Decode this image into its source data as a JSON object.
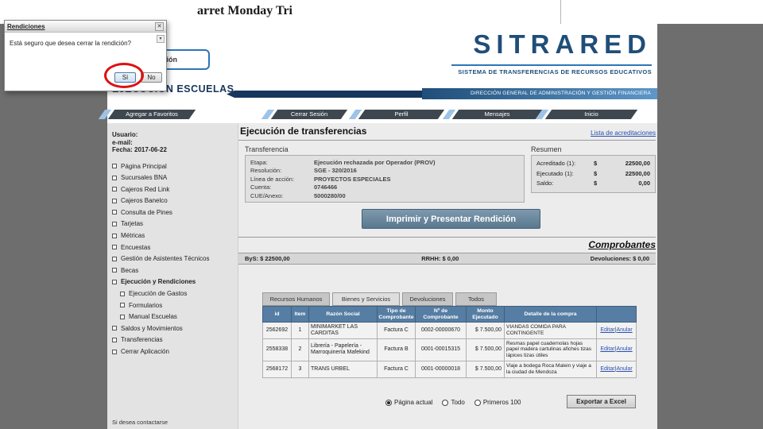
{
  "slide": {
    "top_text": "arret Monday Tri"
  },
  "dialog": {
    "title": "Rendiciones",
    "close_glyph": "✕",
    "dropdown_glyph": "▾",
    "message": "Está seguro que desea cerrar la rendición?",
    "yes_label": "Sí",
    "no_label": "No"
  },
  "header": {
    "logo_text": "de la Nación",
    "brand": "SITRARED",
    "subtitle": "SISTEMA DE TRANSFERENCIAS DE RECURSOS EDUCATIVOS",
    "section_title": "EJECUCIÓN ESCUELAS",
    "department": "DIRECCIÓN GENERAL DE ADMINISTRACIÓN Y GESTIÓN FINANCIERA"
  },
  "nav": {
    "favorites_label": "Agregar a Favoritos",
    "items": [
      {
        "label": "Cerrar Sesión"
      },
      {
        "label": "Perfil"
      },
      {
        "label": "Mensajes"
      },
      {
        "label": "Inicio"
      }
    ]
  },
  "sidebar": {
    "user_label": "Usuario:",
    "email_label": "e-mail:",
    "date_label": "Fecha: 2017-06-22",
    "items": [
      {
        "label": "Página Principal"
      },
      {
        "label": "Sucursales BNA"
      },
      {
        "label": "Cajeros Red Link"
      },
      {
        "label": "Cajeros Banelco"
      },
      {
        "label": "Consulta de Pines"
      },
      {
        "label": "Tarjetas"
      },
      {
        "label": "Métricas"
      },
      {
        "label": "Encuestas"
      },
      {
        "label": "Gestión de Asistentes Técnicos"
      },
      {
        "label": "Becas"
      },
      {
        "label": "Ejecución y Rendiciones"
      },
      {
        "label": "Ejecución de Gastos"
      },
      {
        "label": "Formularios"
      },
      {
        "label": "Manual Escuelas"
      },
      {
        "label": "Saldos y Movimientos"
      },
      {
        "label": "Transferencias"
      },
      {
        "label": "Cerrar Aplicación"
      }
    ],
    "footer_note": "Si desea contactarse"
  },
  "main": {
    "title": "Ejecución de transferencias",
    "acreditaciones_link": "Lista de acreditaciones",
    "transfer_heading": "Transferencia",
    "transfer_fields": [
      {
        "label": "Etapa:",
        "value": "Ejecución rechazada por Operador (PROV)"
      },
      {
        "label": "Resolución:",
        "value": "SGE - 320/2016"
      },
      {
        "label": "Línea de acción:",
        "value": "PROYECTOS ESPECIALES"
      },
      {
        "label": "Cuenta:",
        "value": "0746466"
      },
      {
        "label": "CUE/Anexo:",
        "value": "5000280/00"
      }
    ],
    "summary_heading": "Resumen",
    "summary_rows": [
      {
        "label": "Acreditado (1):",
        "currency": "$",
        "amount": "22500,00"
      },
      {
        "label": "Ejecutado (1):",
        "currency": "$",
        "amount": "22500,00"
      },
      {
        "label": "Saldo:",
        "currency": "$",
        "amount": "0,00"
      }
    ],
    "print_button": "Imprimir y Presentar Rendición",
    "comprobantes_title": "Comprobantes",
    "totals": {
      "bys": "ByS: $ 22500,00",
      "rrhh": "RRHH: $ 0,00",
      "devoluciones": "Devoluciones: $ 0,00"
    },
    "tabs": [
      {
        "label": "Recursos Humanos",
        "active": false
      },
      {
        "label": "Bienes y Servicios",
        "active": true
      },
      {
        "label": "Devoluciones",
        "active": false
      },
      {
        "label": "Todos",
        "active": false
      }
    ],
    "table": {
      "headers": [
        "id",
        "Item",
        "Razón Social",
        "Tipo de Comprobante",
        "Nº de Comprobante",
        "Monto Ejecutado",
        "Detalle de la compra"
      ],
      "edit_label": "Editar",
      "separator": "|",
      "anular_label": "Anular",
      "rows": [
        {
          "id": "2562692",
          "item": "1",
          "razon": "MINIMARKET LAS CARDITAS",
          "tipo": "Factura C",
          "numero": "0002-00000670",
          "monto": "$ 7.500,00",
          "detalle": "VIANDAS COMIDA PARA CONTINGENTE"
        },
        {
          "id": "2558338",
          "item": "2",
          "razon": "Librería - Papelería - Marroquinería Mafekind",
          "tipo": "Factura B",
          "numero": "0001-00015315",
          "monto": "$ 7.500,00",
          "detalle": "Resmas papel cuadernolas hojas papel madera cartulinas afiches tizas lápices tizas útiles"
        },
        {
          "id": "2568172",
          "item": "3",
          "razon": "TRANS URBEL",
          "tipo": "Factura C",
          "numero": "0001-00000018",
          "monto": "$ 7.500,00",
          "detalle": "Viaje a bodega Roca Malein y viaje a la ciudad de Mendoza"
        }
      ]
    },
    "pagination": {
      "options": [
        {
          "label": "Página actual",
          "selected": true
        },
        {
          "label": "Todo",
          "selected": false
        },
        {
          "label": "Primeros 100",
          "selected": false
        }
      ],
      "export_button": "Exportar a Excel"
    }
  },
  "colors": {
    "brand_navy": "#1f4e79",
    "band_blue": "#2e75b6",
    "accent_light_blue": "#9dc3e6",
    "table_header_blue": "#567da3",
    "annotation_red": "#dd1111"
  }
}
